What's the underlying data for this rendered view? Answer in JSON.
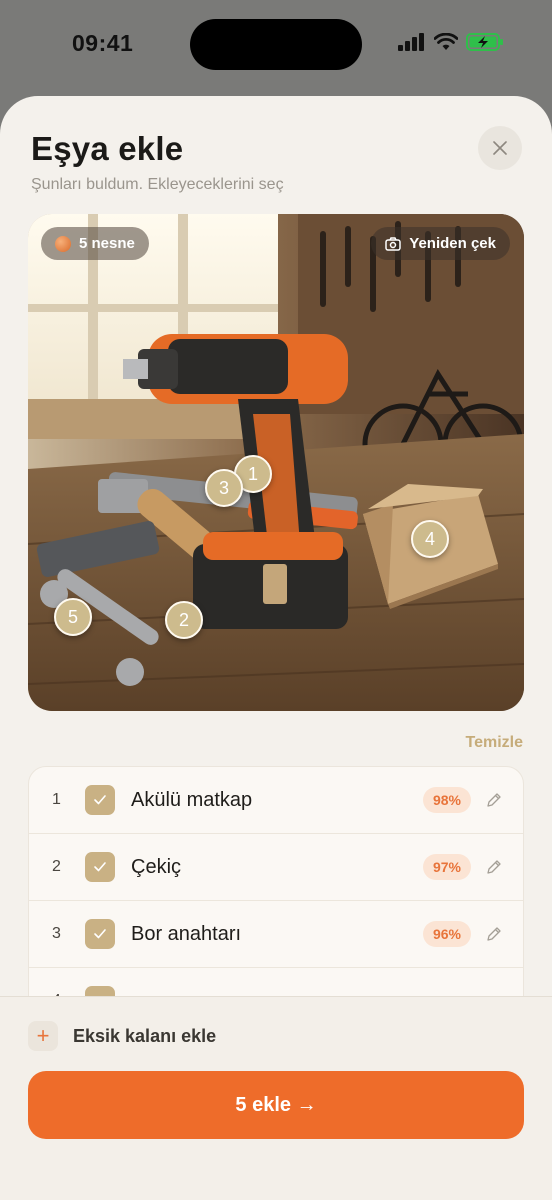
{
  "status_bar": {
    "time": "09:41"
  },
  "sheet": {
    "title": "Eşya ekle",
    "subtitle": "Şunları buldum. Ekleyeceklerini seç",
    "close_icon": "close-icon"
  },
  "photo": {
    "count_label": "5 nesne",
    "retake_label": "Yeniden çek",
    "markers": [
      "1",
      "2",
      "3",
      "4",
      "5"
    ]
  },
  "clear_label": "Temizle",
  "items": [
    {
      "num": "1",
      "name": "Akülü matkap",
      "confidence": "98%",
      "checked": true
    },
    {
      "num": "2",
      "name": "Çekiç",
      "confidence": "97%",
      "checked": true
    },
    {
      "num": "3",
      "name": "Bor anahtarı",
      "confidence": "96%",
      "checked": true
    },
    {
      "num": "4",
      "name": "",
      "confidence": "",
      "checked": true
    }
  ],
  "bottom": {
    "add_missing_label": "Eksik kalanı ekle",
    "cta_label": "5 ekle →"
  },
  "colors": {
    "accent": "#ee6c2a",
    "check": "#c9b184",
    "marker": "#cdbb8d"
  }
}
